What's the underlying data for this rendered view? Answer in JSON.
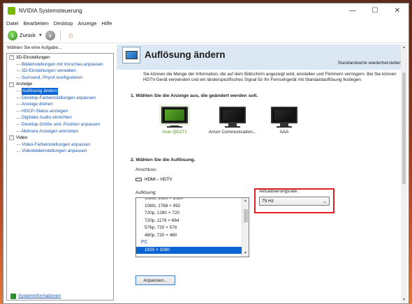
{
  "window": {
    "title": "NVIDIA Systemsteuerung",
    "controls": {
      "minimize": "—",
      "maximize": "☐",
      "close": "✕"
    }
  },
  "menu": [
    "Datei",
    "Bearbeiten",
    "Desktop",
    "Anzeige",
    "Hilfe"
  ],
  "toolbar": {
    "back_label": "Zurück",
    "back_icon": "back-arrow-icon",
    "forward_icon": "forward-arrow-icon",
    "home_icon": "home-icon"
  },
  "sidebar": {
    "heading": "Wählen Sie eine Aufgabe...",
    "tree": [
      {
        "type": "cat",
        "label": "3D-Einstellungen",
        "expander": "−"
      },
      {
        "type": "child",
        "label": "Bildeinstellungen mit Vorschau anpassen"
      },
      {
        "type": "child",
        "label": "3D-Einstellungen verwalten"
      },
      {
        "type": "child",
        "label": "Surround, PhysX konfigurieren"
      },
      {
        "type": "cat",
        "label": "Anzeige",
        "expander": "−"
      },
      {
        "type": "child",
        "label": "Auflösung ändern",
        "selected": true
      },
      {
        "type": "child",
        "label": "Desktop-Farbeinstellungen anpassen"
      },
      {
        "type": "child",
        "label": "Anzeige drehen"
      },
      {
        "type": "child",
        "label": "HDCP-Status anzeigen"
      },
      {
        "type": "child",
        "label": "Digitales Audio einrichten"
      },
      {
        "type": "child",
        "label": "Desktop-Größe und -Position anpassen"
      },
      {
        "type": "child",
        "label": "Mehrere Anzeigen einrichten"
      },
      {
        "type": "cat",
        "label": "Video",
        "expander": "−"
      },
      {
        "type": "child",
        "label": "Video-Farbeinstellungen anpassen"
      },
      {
        "type": "child",
        "label": "Videobildeinstellungen anpassen"
      }
    ],
    "system_info": "Systeminformationen"
  },
  "main": {
    "title": "Auflösung ändern",
    "restore_defaults": "Standardwerte wiederherstellen",
    "description": "Sie können die Menge der Information, die auf dem Bildschirm angezeigt wird, einstellen und Flimmern verringern. Bei Sie können HDTV-Gerät verwenden und ein länderspezifisches Signal für Ihr Fernsehgerät mit Standardauflösung festlegen.",
    "step1": "1. Wählen Sie die Anzeige aus, die geändert werden soll.",
    "displays": [
      {
        "label": "Acer QG271",
        "selected": true
      },
      {
        "label": "Ancor Communication...",
        "selected": false
      },
      {
        "label": "AAA",
        "selected": false
      }
    ],
    "step2": "2. Wählen Sie die Auflösung.",
    "connector_label": "Anschluss:",
    "connector_value": "HDMI – HDTV",
    "resolution_label": "Auflösung:",
    "resolutions": [
      {
        "label": "1080i, 1920 × 1080",
        "type": "item"
      },
      {
        "label": "1080i, 1768 × 992",
        "type": "item"
      },
      {
        "label": "720p, 1280 × 720",
        "type": "item"
      },
      {
        "label": "720p, 1176 × 664",
        "type": "item"
      },
      {
        "label": "576p, 720 × 576",
        "type": "item"
      },
      {
        "label": "480p, 720 × 480",
        "type": "item"
      },
      {
        "label": "PC",
        "type": "group"
      },
      {
        "label": "1920 × 1080",
        "type": "item",
        "selected": true
      }
    ],
    "refresh_label": "Aktualisierungsrate:",
    "refresh_value": "75 Hz",
    "customize_button": "Anpassen..."
  }
}
